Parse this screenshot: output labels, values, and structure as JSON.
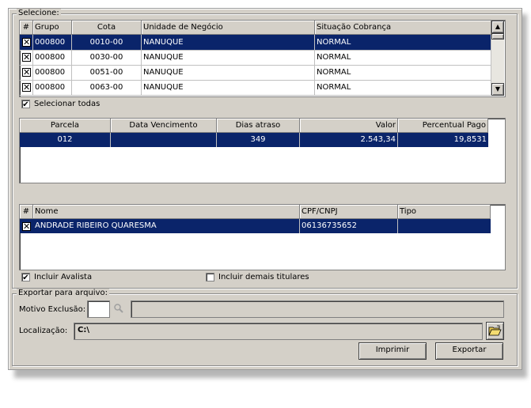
{
  "select_group": {
    "legend": "Selecione:",
    "columns": [
      "#",
      "Grupo",
      "Cota",
      "Unidade de Negócio",
      "Situação Cobrança"
    ],
    "rows": [
      {
        "grupo": "000800",
        "cota": "0010-00",
        "unidade": "NANUQUE",
        "situacao": "NORMAL",
        "checked": true,
        "selected": true
      },
      {
        "grupo": "000800",
        "cota": "0030-00",
        "unidade": "NANUQUE",
        "situacao": "NORMAL",
        "checked": true,
        "selected": false
      },
      {
        "grupo": "000800",
        "cota": "0051-00",
        "unidade": "NANUQUE",
        "situacao": "NORMAL",
        "checked": true,
        "selected": false
      },
      {
        "grupo": "000800",
        "cota": "0063-00",
        "unidade": "NANUQUE",
        "situacao": "NORMAL",
        "checked": true,
        "selected": false
      }
    ],
    "select_all_label": "Selecionar todas",
    "select_all_checked": true
  },
  "parcelas": {
    "columns": [
      "Parcela",
      "Data Vencimento",
      "Dias atraso",
      "Valor",
      "Percentual Pago"
    ],
    "rows": [
      {
        "parcela": "012",
        "vencimento": "",
        "dias": "349",
        "valor": "2.543,34",
        "percentual": "19,8531"
      }
    ]
  },
  "titulares": {
    "columns": [
      "#",
      "Nome",
      "CPF/CNPJ",
      "Tipo"
    ],
    "rows": [
      {
        "nome": "ANDRADE RIBEIRO QUARESMA",
        "cpf": "06136735652",
        "tipo": "",
        "checked": true
      }
    ],
    "incluir_avalista_label": "Incluir Avalista",
    "incluir_avalista_checked": true,
    "incluir_demais_label": "Incluir demais titulares",
    "incluir_demais_checked": false
  },
  "export_group": {
    "legend": "Exportar para arquivo:",
    "motivo_label": "Motivo Exclusão:",
    "motivo_value": "",
    "motivo_desc": "",
    "localizacao_label": "Localização:",
    "localizacao_value": "C:\\",
    "imprimir_label": "Imprimir",
    "exportar_label": "Exportar"
  },
  "check_mark": "✔",
  "x_mark": "✕"
}
